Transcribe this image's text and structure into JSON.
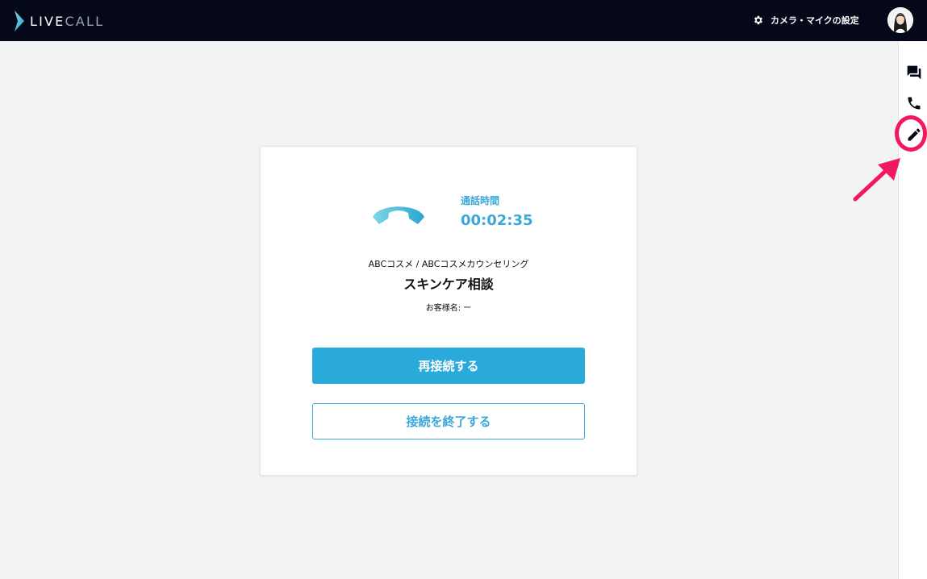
{
  "header": {
    "logo": {
      "part1": "LIVE",
      "part2": "CALL"
    },
    "settings_label": "カメラ・マイクの設定",
    "settings_icon": "gear-icon",
    "avatar": "user-avatar"
  },
  "sidebar": {
    "items": [
      {
        "icon": "chat-icon"
      },
      {
        "icon": "phone-icon"
      },
      {
        "icon": "pencil-icon"
      }
    ]
  },
  "call": {
    "icon": "hang-up-icon",
    "duration_label": "通話時間",
    "duration": "00:02:35",
    "shop": "ABCコスメ / ABCコスメカウンセリング",
    "title": "スキンケア相談",
    "customer": "お客様名: ー",
    "reconnect_label": "再接続する",
    "end_label": "接続を終了する"
  },
  "colors": {
    "topbar": "#040819",
    "accent": "#2aaada",
    "highlight": "#f2185d"
  }
}
